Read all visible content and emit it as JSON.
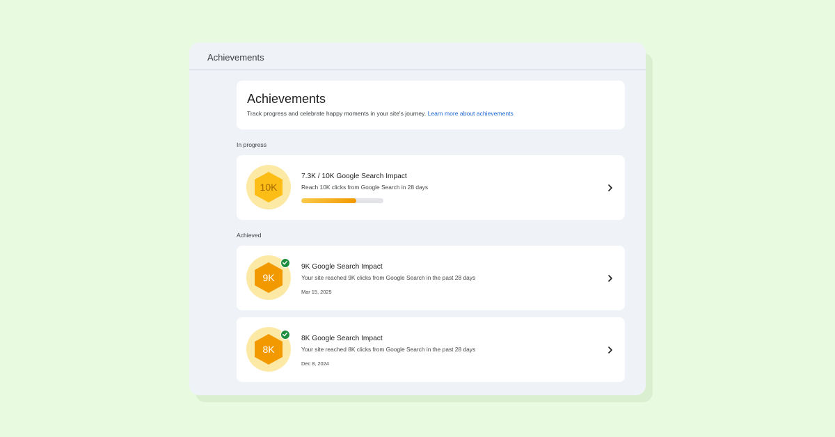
{
  "window": {
    "title": "Achievements"
  },
  "intro": {
    "title": "Achievements",
    "description": "Track progress and celebrate happy moments in your site's journey.",
    "link": "Learn more about achievements"
  },
  "sections": {
    "in_progress": "In progress",
    "achieved": "Achieved"
  },
  "in_progress_item": {
    "badge": "10K",
    "title": "7.3K / 10K Google Search Impact",
    "description": "Reach 10K clicks from Google Search in 28 days",
    "progress": 0.67
  },
  "achieved_items": [
    {
      "badge": "9K",
      "title": "9K Google Search Impact",
      "description": "Your site reached 9K clicks from Google Search in the past 28 days",
      "date": "Mar 15, 2025"
    },
    {
      "badge": "8K",
      "title": "8K Google Search Impact",
      "description": "Your site reached 8K clicks from Google Search in the past 28 days",
      "date": "Dec 8, 2024"
    }
  ],
  "icons": {
    "chevron": "chevron-right-icon",
    "check": "check-circle-icon",
    "badge": "hexagon-badge-icon"
  },
  "colors": {
    "background": "#e8fbe0",
    "window": "#eff3f8",
    "badge_circle": "#fde9a6",
    "badge_in_progress": "#fbbd16",
    "badge_achieved": "#f29900",
    "check": "#1e8e3e",
    "link": "#1a66d2"
  }
}
